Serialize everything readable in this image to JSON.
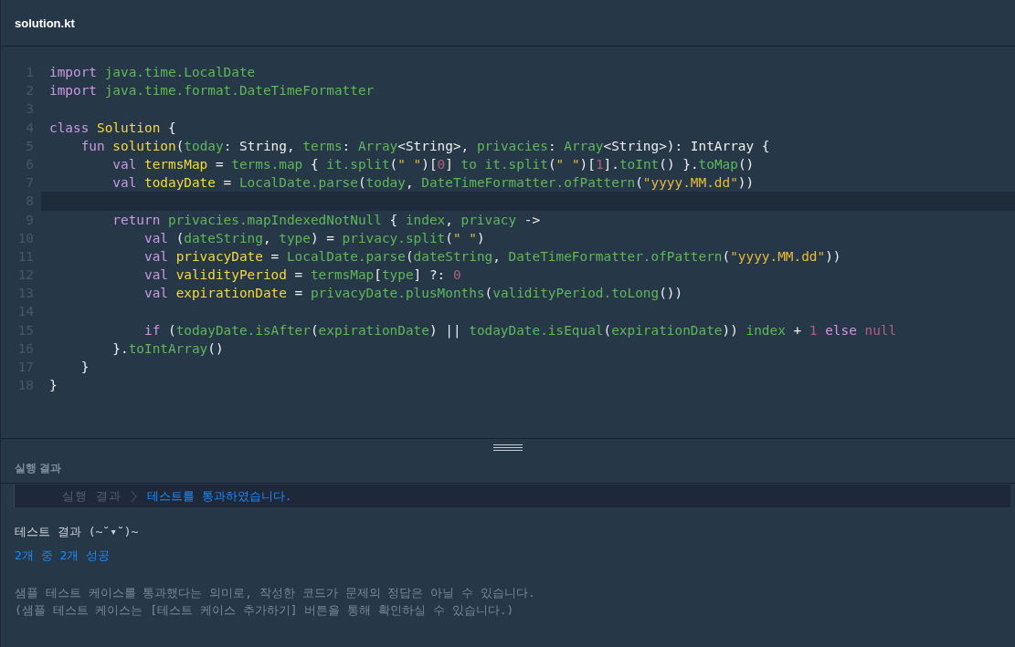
{
  "editor": {
    "filename": "solution.kt",
    "lines": [
      {
        "number": "1",
        "selected": false,
        "tokens": [
          {
            "text": "import",
            "kind": "keyword"
          },
          {
            "text": " java.time.LocalDate",
            "kind": "name"
          }
        ]
      },
      {
        "number": "2",
        "selected": false,
        "tokens": [
          {
            "text": "import",
            "kind": "keyword"
          },
          {
            "text": " java.time.format.DateTimeFormatter",
            "kind": "name"
          }
        ]
      },
      {
        "number": "3",
        "selected": false
      },
      {
        "number": "4",
        "selected": false,
        "tokens": [
          {
            "text": "class",
            "kind": "keyword"
          },
          {
            "text": " Solution",
            "kind": "def"
          },
          {
            "text": " {",
            "kind": "plain"
          }
        ]
      },
      {
        "number": "5",
        "selected": false,
        "tokens": [
          {
            "text": "    fun",
            "kind": "keyword"
          },
          {
            "text": " solution",
            "kind": "def"
          },
          {
            "text": "(",
            "kind": "plain"
          },
          {
            "text": "today",
            "kind": "name"
          },
          {
            "text": ": String, ",
            "kind": "plain"
          },
          {
            "text": "terms",
            "kind": "name"
          },
          {
            "text": ": ",
            "kind": "plain"
          },
          {
            "text": "Array",
            "kind": "name"
          },
          {
            "text": "<String>, ",
            "kind": "plain"
          },
          {
            "text": "privacies",
            "kind": "name"
          },
          {
            "text": ": ",
            "kind": "plain"
          },
          {
            "text": "Array",
            "kind": "name"
          },
          {
            "text": "<String>): IntArray {",
            "kind": "plain"
          }
        ]
      },
      {
        "number": "6",
        "selected": false,
        "tokens": [
          {
            "text": "        val",
            "kind": "keyword"
          },
          {
            "text": " termsMap",
            "kind": "def"
          },
          {
            "text": " = ",
            "kind": "plain"
          },
          {
            "text": "terms.map",
            "kind": "name"
          },
          {
            "text": " { ",
            "kind": "plain"
          },
          {
            "text": "it.split",
            "kind": "name"
          },
          {
            "text": "(",
            "kind": "plain"
          },
          {
            "text": "\" \"",
            "kind": "string"
          },
          {
            "text": ")[",
            "kind": "plain"
          },
          {
            "text": "0",
            "kind": "number"
          },
          {
            "text": "] ",
            "kind": "plain"
          },
          {
            "text": "to it.split",
            "kind": "name"
          },
          {
            "text": "(",
            "kind": "plain"
          },
          {
            "text": "\" \"",
            "kind": "string"
          },
          {
            "text": ")[",
            "kind": "plain"
          },
          {
            "text": "1",
            "kind": "number"
          },
          {
            "text": "].",
            "kind": "plain"
          },
          {
            "text": "toInt",
            "kind": "name"
          },
          {
            "text": "() }.",
            "kind": "plain"
          },
          {
            "text": "toMap",
            "kind": "name"
          },
          {
            "text": "()",
            "kind": "plain"
          }
        ]
      },
      {
        "number": "7",
        "selected": false,
        "tokens": [
          {
            "text": "        val",
            "kind": "keyword"
          },
          {
            "text": " todayDate",
            "kind": "def"
          },
          {
            "text": " = ",
            "kind": "plain"
          },
          {
            "text": "LocalDate.parse",
            "kind": "name"
          },
          {
            "text": "(",
            "kind": "plain"
          },
          {
            "text": "today",
            "kind": "name"
          },
          {
            "text": ", ",
            "kind": "plain"
          },
          {
            "text": "DateTimeFormatter.ofPattern",
            "kind": "name"
          },
          {
            "text": "(",
            "kind": "plain"
          },
          {
            "text": "\"yyyy.MM.dd\"",
            "kind": "string"
          },
          {
            "text": "))",
            "kind": "plain"
          }
        ]
      },
      {
        "number": "8",
        "selected": true
      },
      {
        "number": "9",
        "selected": false,
        "tokens": [
          {
            "text": "        return",
            "kind": "keyword"
          },
          {
            "text": " privacies.mapIndexedNotNull",
            "kind": "name"
          },
          {
            "text": " { ",
            "kind": "plain"
          },
          {
            "text": "index",
            "kind": "name"
          },
          {
            "text": ", ",
            "kind": "plain"
          },
          {
            "text": "privacy",
            "kind": "name"
          },
          {
            "text": " ->",
            "kind": "plain"
          }
        ]
      },
      {
        "number": "10",
        "selected": false,
        "tokens": [
          {
            "text": "            val",
            "kind": "keyword"
          },
          {
            "text": " (",
            "kind": "plain"
          },
          {
            "text": "dateString",
            "kind": "name"
          },
          {
            "text": ", ",
            "kind": "plain"
          },
          {
            "text": "type",
            "kind": "name"
          },
          {
            "text": ") = ",
            "kind": "plain"
          },
          {
            "text": "privacy.split",
            "kind": "name"
          },
          {
            "text": "(",
            "kind": "plain"
          },
          {
            "text": "\" \"",
            "kind": "string"
          },
          {
            "text": ")",
            "kind": "plain"
          }
        ]
      },
      {
        "number": "11",
        "selected": false,
        "tokens": [
          {
            "text": "            val",
            "kind": "keyword"
          },
          {
            "text": " privacyDate",
            "kind": "def"
          },
          {
            "text": " = ",
            "kind": "plain"
          },
          {
            "text": "LocalDate.parse",
            "kind": "name"
          },
          {
            "text": "(",
            "kind": "plain"
          },
          {
            "text": "dateString",
            "kind": "name"
          },
          {
            "text": ", ",
            "kind": "plain"
          },
          {
            "text": "DateTimeFormatter.ofPattern",
            "kind": "name"
          },
          {
            "text": "(",
            "kind": "plain"
          },
          {
            "text": "\"yyyy.MM.dd\"",
            "kind": "string"
          },
          {
            "text": "))",
            "kind": "plain"
          }
        ]
      },
      {
        "number": "12",
        "selected": false,
        "tokens": [
          {
            "text": "            val",
            "kind": "keyword"
          },
          {
            "text": " validityPeriod",
            "kind": "def"
          },
          {
            "text": " = ",
            "kind": "plain"
          },
          {
            "text": "termsMap",
            "kind": "name"
          },
          {
            "text": "[",
            "kind": "plain"
          },
          {
            "text": "type",
            "kind": "name"
          },
          {
            "text": "] ?: ",
            "kind": "plain"
          },
          {
            "text": "0",
            "kind": "number"
          }
        ]
      },
      {
        "number": "13",
        "selected": false,
        "tokens": [
          {
            "text": "            val",
            "kind": "keyword"
          },
          {
            "text": " expirationDate",
            "kind": "def"
          },
          {
            "text": " = ",
            "kind": "plain"
          },
          {
            "text": "privacyDate.plusMonths",
            "kind": "name"
          },
          {
            "text": "(",
            "kind": "plain"
          },
          {
            "text": "validityPeriod.toLong",
            "kind": "name"
          },
          {
            "text": "())",
            "kind": "plain"
          }
        ]
      },
      {
        "number": "14",
        "selected": false
      },
      {
        "number": "15",
        "selected": false,
        "tokens": [
          {
            "text": "            if",
            "kind": "keyword"
          },
          {
            "text": " (",
            "kind": "plain"
          },
          {
            "text": "todayDate.isAfter",
            "kind": "name"
          },
          {
            "text": "(",
            "kind": "plain"
          },
          {
            "text": "expirationDate",
            "kind": "name"
          },
          {
            "text": ") || ",
            "kind": "plain"
          },
          {
            "text": "todayDate.isEqual",
            "kind": "name"
          },
          {
            "text": "(",
            "kind": "plain"
          },
          {
            "text": "expirationDate",
            "kind": "name"
          },
          {
            "text": ")) ",
            "kind": "plain"
          },
          {
            "text": "index",
            "kind": "name"
          },
          {
            "text": " + ",
            "kind": "plain"
          },
          {
            "text": "1",
            "kind": "number"
          },
          {
            "text": " else",
            "kind": "keyword"
          },
          {
            "text": " null",
            "kind": "number"
          }
        ]
      },
      {
        "number": "16",
        "selected": false,
        "tokens": [
          {
            "text": "        }.",
            "kind": "plain"
          },
          {
            "text": "toIntArray",
            "kind": "name"
          },
          {
            "text": "()",
            "kind": "plain"
          }
        ]
      },
      {
        "number": "17",
        "selected": false,
        "tokens": [
          {
            "text": "    }",
            "kind": "plain"
          }
        ]
      },
      {
        "number": "18",
        "selected": false,
        "tokens": [
          {
            "text": "}",
            "kind": "plain"
          }
        ]
      }
    ]
  },
  "results": {
    "title": "실행 결과",
    "status_label": "실행 결과",
    "status_message": "테스트를 통과하였습니다.",
    "heading": "테스트 결과 (~˘▾˘)~",
    "summary": "2개 중 2개 성공",
    "notes": [
      "샘플 테스트 케이스를 통과했다는 의미로, 작성한 코드가 문제의 정답은 아닐 수 있습니다.",
      "(샘플 테스트 케이스는 [테스트 케이스 추가하기] 버튼을 통해 확인하실 수 있습니다.)"
    ]
  }
}
